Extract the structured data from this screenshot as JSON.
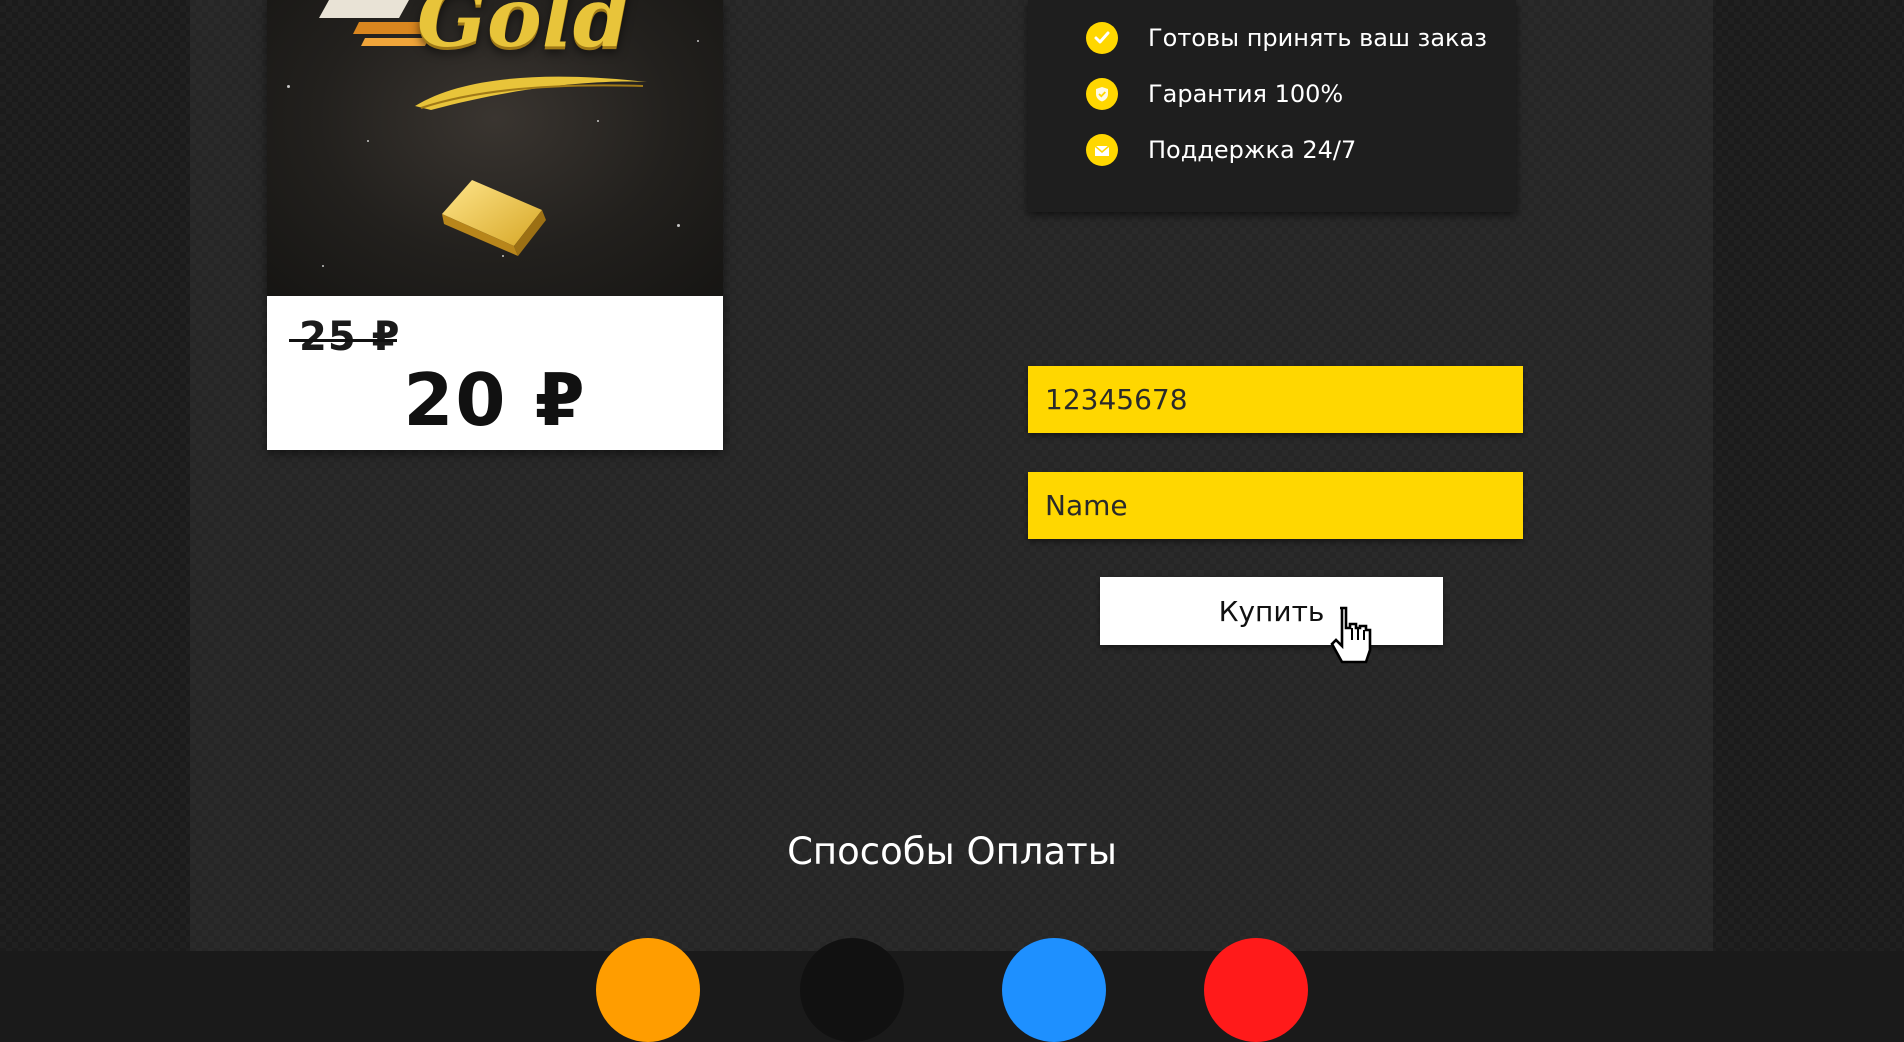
{
  "product": {
    "image_alt": "Gold",
    "old_price": "25 ₽",
    "new_price": "20 ₽"
  },
  "features": [
    {
      "icon": "check-icon",
      "label": "Готовы принять ваш заказ"
    },
    {
      "icon": "shield-icon",
      "label": "Гарантия 100%"
    },
    {
      "icon": "envelope-icon",
      "label": "Поддержка 24/7"
    }
  ],
  "form": {
    "id_value": "12345678",
    "name_placeholder": "Name",
    "buy_label": "Купить"
  },
  "payment": {
    "title": "Способы Оплаты",
    "methods": [
      {
        "color": "#ff9d00"
      },
      {
        "color": "#111111"
      },
      {
        "color": "#1e90ff"
      },
      {
        "color": "#ff1a1a"
      }
    ]
  },
  "colors": {
    "accent": "#ffd700",
    "background": "#262626"
  }
}
